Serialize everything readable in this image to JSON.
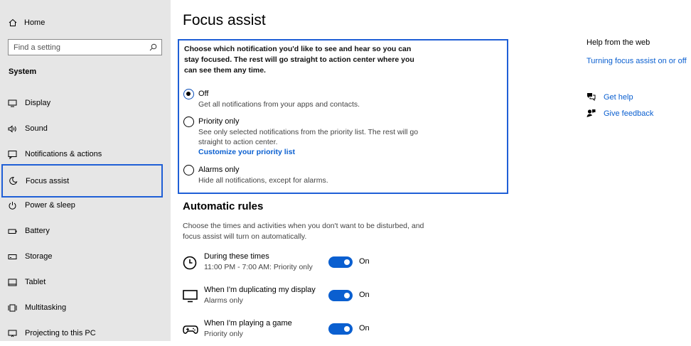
{
  "sidebar": {
    "home_label": "Home",
    "search_placeholder": "Find a setting",
    "section_heading": "System",
    "items": [
      {
        "label": "Display",
        "icon": "display-icon"
      },
      {
        "label": "Sound",
        "icon": "sound-icon"
      },
      {
        "label": "Notifications & actions",
        "icon": "notifications-icon"
      },
      {
        "label": "Focus assist",
        "icon": "moon-icon"
      },
      {
        "label": "Power & sleep",
        "icon": "power-icon"
      },
      {
        "label": "Battery",
        "icon": "battery-icon"
      },
      {
        "label": "Storage",
        "icon": "storage-icon"
      },
      {
        "label": "Tablet",
        "icon": "tablet-icon"
      },
      {
        "label": "Multitasking",
        "icon": "multitasking-icon"
      },
      {
        "label": "Projecting to this PC",
        "icon": "projecting-icon"
      }
    ],
    "active_index": 3
  },
  "main": {
    "title": "Focus assist",
    "intro": "Choose which notification you'd like to see and hear so you can stay focused. The rest will go straight to action center where you can see them any time.",
    "options": [
      {
        "label": "Off",
        "description": "Get all notifications from your apps and contacts.",
        "checked": true
      },
      {
        "label": "Priority only",
        "description": "See only selected notifications from the priority list. The rest will go straight to action center.",
        "link": "Customize your priority list",
        "checked": false
      },
      {
        "label": "Alarms only",
        "description": "Hide all notifications, except for alarms.",
        "checked": false
      }
    ],
    "automatic_rules": {
      "heading": "Automatic rules",
      "description": "Choose the times and activities when you don't want to be disturbed, and focus assist will turn on automatically.",
      "rules": [
        {
          "title": "During these times",
          "subtitle": "11:00 PM - 7:00 AM: Priority only",
          "state": "On",
          "icon": "clock-icon"
        },
        {
          "title": "When I'm duplicating my display",
          "subtitle": "Alarms only",
          "state": "On",
          "icon": "monitor-icon"
        },
        {
          "title": "When I'm playing a game",
          "subtitle": "Priority only",
          "state": "On",
          "icon": "gamepad-icon"
        }
      ]
    }
  },
  "right_panel": {
    "heading": "Help from the web",
    "web_link": "Turning focus assist on or off",
    "get_help": "Get help",
    "give_feedback": "Give feedback"
  },
  "colors": {
    "accent": "#0a5fd0",
    "highlight_border": "#1f5fd6",
    "sidebar_bg": "#e6e6e6"
  }
}
